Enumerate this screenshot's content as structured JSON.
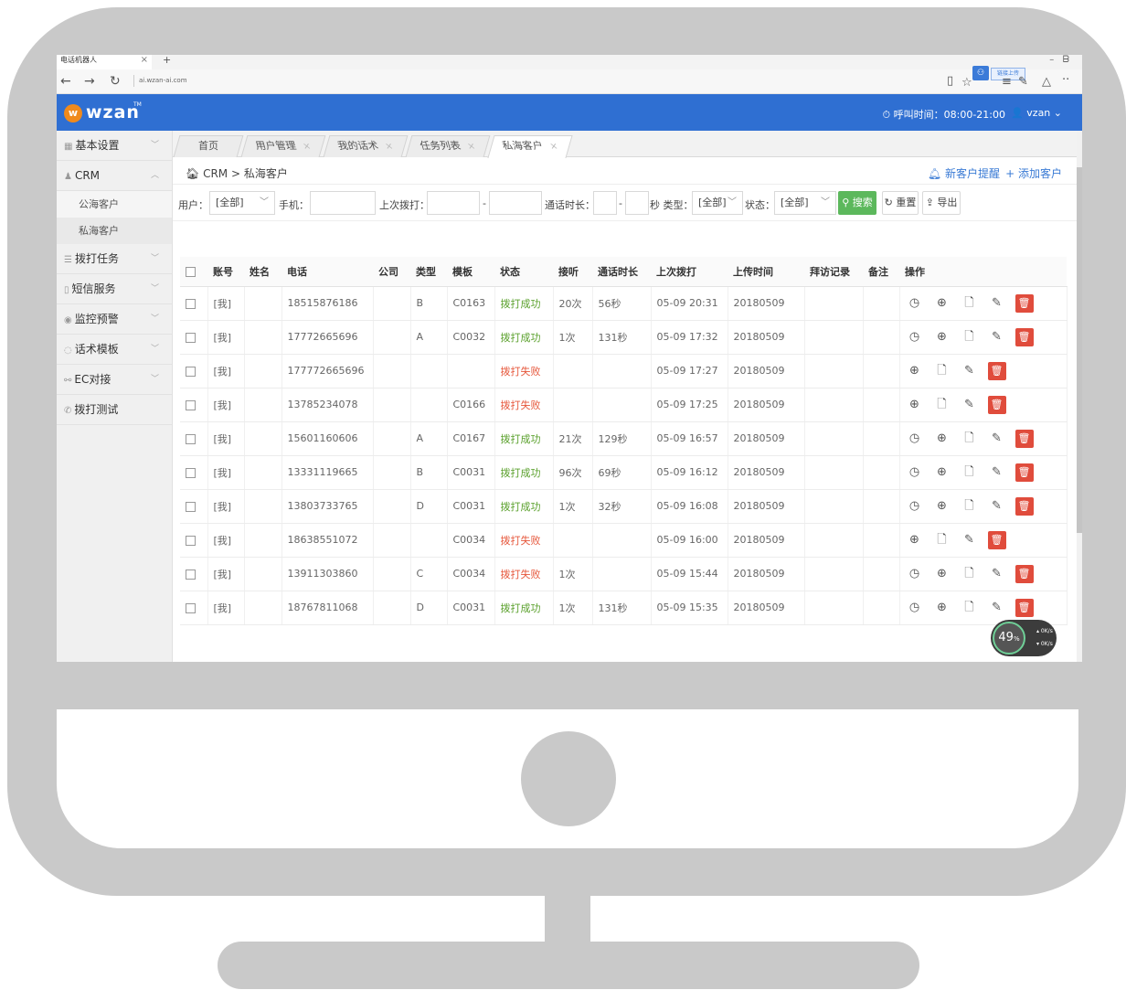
{
  "browser": {
    "tab_title": "电话机器人",
    "url": "ai.wzan-ai.com",
    "extension_label": "链接上传"
  },
  "header": {
    "logo_text": "wzan",
    "call_time": "呼叫时间：08:00-21:00",
    "user": "vzan"
  },
  "sidebar": {
    "items": [
      {
        "label": "基本设置",
        "icon": "grid-icon"
      },
      {
        "label": "CRM",
        "icon": "users-icon"
      },
      {
        "label": "公海客户"
      },
      {
        "label": "私海客户"
      },
      {
        "label": "拨打任务",
        "icon": "list-icon"
      },
      {
        "label": "短信服务",
        "icon": "phone-icon"
      },
      {
        "label": "监控预警",
        "icon": "eye-icon"
      },
      {
        "label": "话术模板",
        "icon": "chat-icon"
      },
      {
        "label": "EC对接",
        "icon": "link-icon"
      },
      {
        "label": "拨打测试",
        "icon": "handset-icon"
      }
    ]
  },
  "tabs": [
    "首页",
    "用户管理",
    "我的话术",
    "任务列表",
    "私海客户"
  ],
  "breadcrumb": {
    "root": "CRM",
    "sep": ">",
    "current": "私海客户"
  },
  "actions": {
    "remind": "新客户提醒",
    "add": "+ 添加客户"
  },
  "filters": {
    "user_label": "用户：",
    "user_value": "[全部]",
    "phone_label": "手机：",
    "last_call_label": "上次拨打：",
    "duration_label": "通话时长：",
    "sec_type_label": "秒 类型：",
    "type_value": "[全部]",
    "status_label": "状态：",
    "status_value": "[全部]",
    "search": "搜索",
    "reset": "重置",
    "export": "导出"
  },
  "table": {
    "columns": [
      "账号",
      "姓名",
      "电话",
      "公司",
      "类型",
      "模板",
      "状态",
      "接听",
      "通话时长",
      "上次拨打",
      "上传时间",
      "拜访记录",
      "备注",
      "操作"
    ],
    "rows": [
      {
        "account": "[我]",
        "name": "",
        "phone": "18515876186",
        "company": "",
        "type": "B",
        "template": "C0163",
        "status": "拨打成功",
        "answer": "20次",
        "duration": "56秒",
        "last": "05-09 20:31",
        "upload": "20180509",
        "clock": true
      },
      {
        "account": "[我]",
        "name": "",
        "phone": "17772665696",
        "company": "",
        "type": "A",
        "template": "C0032",
        "status": "拨打成功",
        "answer": "1次",
        "duration": "131秒",
        "last": "05-09 17:32",
        "upload": "20180509",
        "clock": true
      },
      {
        "account": "[我]",
        "name": "",
        "phone": "177772665696",
        "company": "",
        "type": "",
        "template": "",
        "status": "拨打失败",
        "answer": "",
        "duration": "",
        "last": "05-09 17:27",
        "upload": "20180509",
        "clock": false
      },
      {
        "account": "[我]",
        "name": "",
        "phone": "13785234078",
        "company": "",
        "type": "",
        "template": "C0166",
        "status": "拨打失败",
        "answer": "",
        "duration": "",
        "last": "05-09 17:25",
        "upload": "20180509",
        "clock": false
      },
      {
        "account": "[我]",
        "name": "",
        "phone": "15601160606",
        "company": "",
        "type": "A",
        "template": "C0167",
        "status": "拨打成功",
        "answer": "21次",
        "duration": "129秒",
        "last": "05-09 16:57",
        "upload": "20180509",
        "clock": true
      },
      {
        "account": "[我]",
        "name": "",
        "phone": "13331119665",
        "company": "",
        "type": "B",
        "template": "C0031",
        "status": "拨打成功",
        "answer": "96次",
        "duration": "69秒",
        "last": "05-09 16:12",
        "upload": "20180509",
        "clock": true
      },
      {
        "account": "[我]",
        "name": "",
        "phone": "13803733765",
        "company": "",
        "type": "D",
        "template": "C0031",
        "status": "拨打成功",
        "answer": "1次",
        "duration": "32秒",
        "last": "05-09 16:08",
        "upload": "20180509",
        "clock": true
      },
      {
        "account": "[我]",
        "name": "",
        "phone": "18638551072",
        "company": "",
        "type": "",
        "template": "C0034",
        "status": "拨打失败",
        "answer": "",
        "duration": "",
        "last": "05-09 16:00",
        "upload": "20180509",
        "clock": false
      },
      {
        "account": "[我]",
        "name": "",
        "phone": "13911303860",
        "company": "",
        "type": "C",
        "template": "C0034",
        "status": "拨打失败",
        "answer": "1次",
        "duration": "",
        "last": "05-09 15:44",
        "upload": "20180509",
        "clock": true
      },
      {
        "account": "[我]",
        "name": "",
        "phone": "18767811068",
        "company": "",
        "type": "D",
        "template": "C0031",
        "status": "拨打成功",
        "answer": "1次",
        "duration": "131秒",
        "last": "05-09 15:35",
        "upload": "20180509",
        "clock": true
      }
    ]
  },
  "widget": {
    "percent": "49",
    "percent_unit": "%",
    "up": "0K/s",
    "down": "0K/s"
  },
  "colors": {
    "brand_blue": "#2f6fd2",
    "success_green": "#5aa02c",
    "fail_red": "#e6573b",
    "search_green": "#5cb85c",
    "delete_red": "#e04c3c",
    "bezel_gray": "#c9c9c9"
  }
}
